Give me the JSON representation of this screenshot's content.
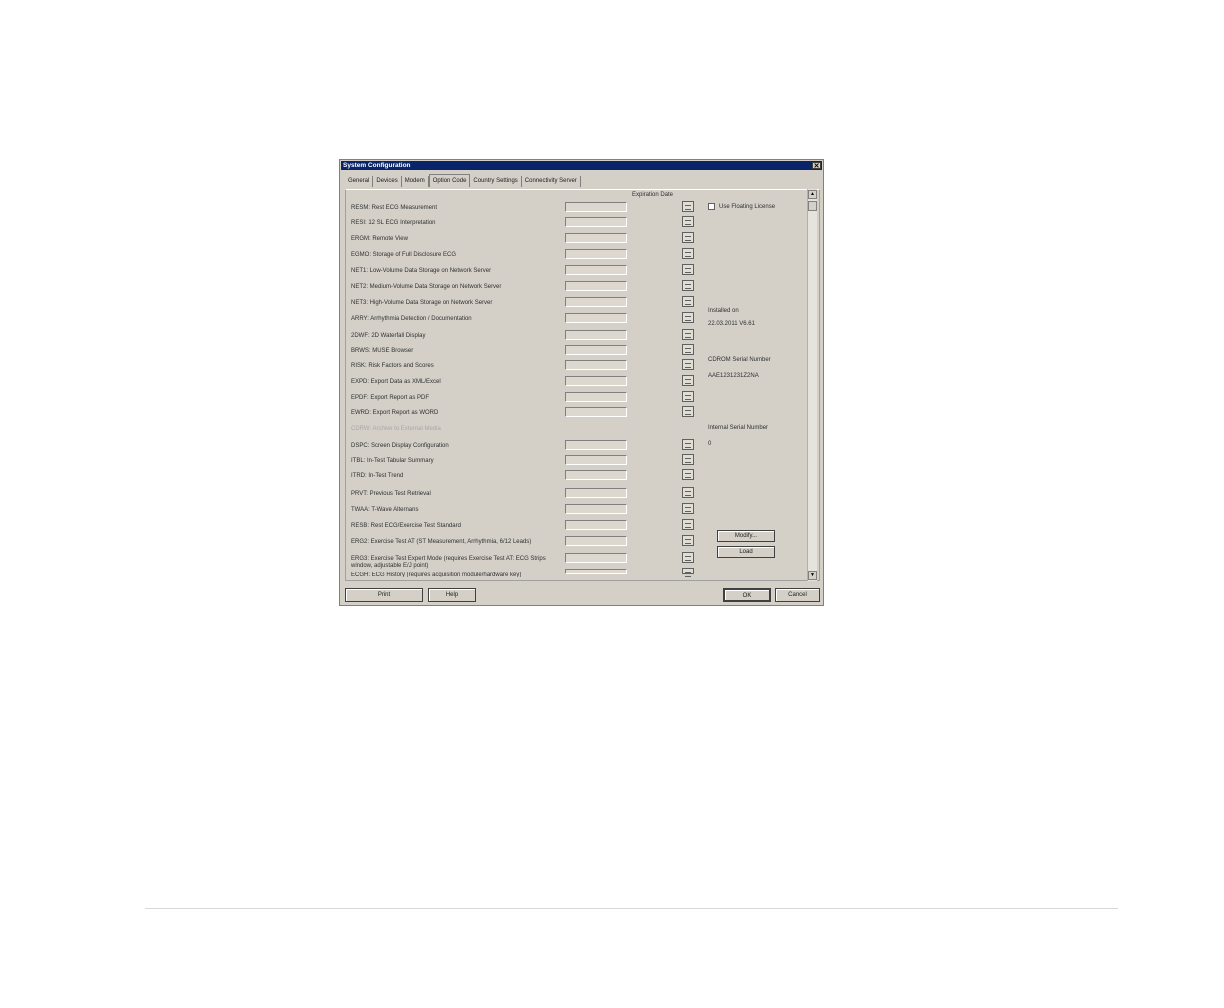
{
  "window": {
    "title": "System Configuration",
    "close_glyph": "✕"
  },
  "tabs": [
    {
      "label": "General"
    },
    {
      "label": "Devices"
    },
    {
      "label": "Modem"
    },
    {
      "label": "Option Code",
      "active": true
    },
    {
      "label": "Country Settings"
    },
    {
      "label": "Connectivity Server"
    }
  ],
  "options": {
    "expiration_header": "Expiration Date",
    "items": [
      {
        "label": "RESM: Rest ECG Measurement"
      },
      {
        "label": "RESI: 12 SL ECG Interpretation"
      },
      {
        "label": "ERGM: Remote View"
      },
      {
        "label": "EGMO: Storage of Full Disclosure ECG"
      },
      {
        "label": "NET1: Low-Volume Data Storage on Network Server"
      },
      {
        "label": "NET2: Medium-Volume Data Storage on Network Server"
      },
      {
        "label": "NET3: High-Volume Data Storage on Network Server"
      },
      {
        "label": "ARRY: Arrhythmia Detection / Documentation"
      },
      {
        "label": "2DWF: 2D Waterfall Display"
      },
      {
        "label": "BRWS: MUSE Browser"
      },
      {
        "label": "RISK: Risk Factors and Scores"
      },
      {
        "label": "EXPD: Export Data as XML/Excel"
      },
      {
        "label": "EPDF: Export Report as PDF"
      },
      {
        "label": "EWRD: Export Report as WORD"
      },
      {
        "label": "CDRW: Archive to External Media",
        "disabled": true
      },
      {
        "label": "DSPC: Screen Display Configuration"
      },
      {
        "label": "ITBL: In-Test Tabular Summary"
      },
      {
        "label": "ITRD: In-Test Trend"
      },
      {
        "label": "PRVT: Previous Test Retrieval"
      },
      {
        "label": "TWAA: T-Wave Alternans"
      },
      {
        "label": "RESB: Rest ECG/Exercise Test Standard"
      },
      {
        "label": "ERG2: Exercise Test AT (ST Measurement, Arrhythmia, 6/12 Leads)"
      },
      {
        "label": "ERG3: Exercise Test Expert Mode (requires Exercise Test AT: ECG Strips window, adjustable E/J point)"
      },
      {
        "label": "ECGH: ECG History (requires acquisition module/hardware key)"
      }
    ]
  },
  "side": {
    "floating_license_label": "Use Floating License",
    "installed_on_label": "Installed on",
    "installed_on_value": "22.03.2011 V6.61",
    "cdrom_serial_label": "CDROM Serial Number",
    "cdrom_serial_value": "AAE1231231Z2NA",
    "internal_serial_label": "Internal Serial Number",
    "internal_serial_value": "0",
    "modify_button": "Modify...",
    "load_button": "Load"
  },
  "footer_buttons": {
    "print": "Print",
    "help": "Help",
    "ok": "OK",
    "cancel": "Cancel"
  },
  "icons": {
    "calendar": "calendar-icon",
    "scroll_up": "▲",
    "scroll_down": "▼"
  },
  "colors": {
    "title_bar": "#0a246a",
    "dialog_bg": "#d4d0c8"
  }
}
